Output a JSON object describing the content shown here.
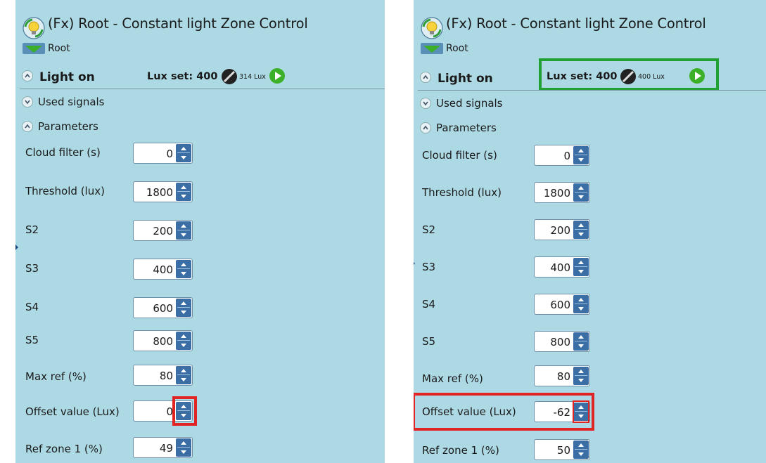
{
  "colors": {
    "panel_bg": "#add9e5",
    "marker_red": "#e02424",
    "marker_green": "#22a033",
    "spinner_btn": "#3a6ea5",
    "play_green": "#3cb028"
  },
  "panels": [
    {
      "title": "(Fx) Root - Constant light Zone Control",
      "subtitle": "Root",
      "light_on": "Light on",
      "lux_set": "Lux set: 400",
      "lux_read": "314 Lux",
      "used_signals": "Used signals",
      "parameters": "Parameters",
      "params": [
        {
          "label": "Cloud filter (s)",
          "value": "0"
        },
        {
          "label": "Threshold (lux)",
          "value": "1800"
        },
        {
          "label": "S2",
          "value": "200"
        },
        {
          "label": "S3",
          "value": "400"
        },
        {
          "label": "S4",
          "value": "600"
        },
        {
          "label": "S5",
          "value": "800"
        },
        {
          "label": "Max ref (%)",
          "value": "80"
        },
        {
          "label": "Offset value (Lux)",
          "value": "0"
        },
        {
          "label": "Ref zone 1 (%)",
          "value": "49"
        }
      ]
    },
    {
      "title": "(Fx) Root - Constant light Zone Control",
      "subtitle": "Root",
      "light_on": "Light on",
      "lux_set": "Lux set: 400",
      "lux_read": "400 Lux",
      "used_signals": "Used signals",
      "parameters": "Parameters",
      "params": [
        {
          "label": "Cloud filter (s)",
          "value": "0"
        },
        {
          "label": "Threshold (lux)",
          "value": "1800"
        },
        {
          "label": "S2",
          "value": "200"
        },
        {
          "label": "S3",
          "value": "400"
        },
        {
          "label": "S4",
          "value": "600"
        },
        {
          "label": "S5",
          "value": "800"
        },
        {
          "label": "Max ref (%)",
          "value": "80"
        },
        {
          "label": "Offset value (Lux)",
          "value": "-62"
        },
        {
          "label": "Ref zone 1 (%)",
          "value": "50"
        }
      ]
    }
  ]
}
